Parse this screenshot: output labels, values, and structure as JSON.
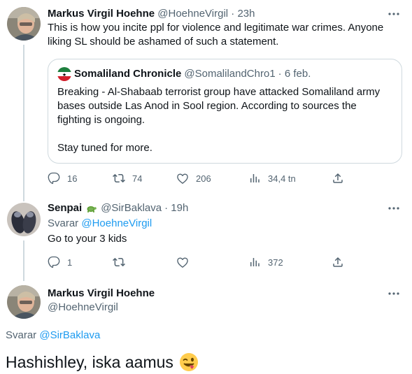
{
  "tweets": [
    {
      "author_name": "Markus Virgil Hoehne",
      "author_handle": "@HoehneVirgil",
      "time": "· 23h",
      "text": "This is how you incite ppl for violence and legitimate war crimes. Anyone liking SL should be ashamed of such a statement.",
      "quote": {
        "author_name": "Somaliland Chronicle",
        "author_handle": "@SomalilandChro1",
        "time": "· 6 feb.",
        "text_lines": [
          "Breaking - Al-Shabaab terrorist group have attacked Somaliland army bases outside Las Anod in Sool region. According to sources the fighting is ongoing.",
          "Stay tuned for more."
        ]
      },
      "actions": {
        "replies": "16",
        "retweets": "74",
        "likes": "206",
        "views": "34,4 tn"
      }
    },
    {
      "author_name": "Senpai",
      "author_handle": "@SirBaklava",
      "time": "· 19h",
      "reply_prefix": "Svarar",
      "reply_to": "@HoehneVirgil",
      "text": "Go to your 3 kids",
      "actions": {
        "replies": "1",
        "retweets": "",
        "likes": "",
        "views": "372"
      }
    },
    {
      "author_name": "Markus Virgil Hoehne",
      "author_handle": "@HoehneVirgil",
      "reply_prefix": "Svarar",
      "reply_to": "@SirBaklava",
      "text": "Hashishley, iska aamus"
    }
  ],
  "icons": {
    "more": "more-horizontal-icon",
    "reply": "reply-icon",
    "retweet": "retweet-icon",
    "like": "heart-icon",
    "views": "views-icon",
    "share": "share-icon",
    "turtle": "turtle-emoji",
    "emoji": "winking-face-with-tongue-emoji"
  },
  "colors": {
    "link": "#1d9bf0",
    "muted": "#536471",
    "text": "#0f1419",
    "border": "#cfd9de"
  }
}
